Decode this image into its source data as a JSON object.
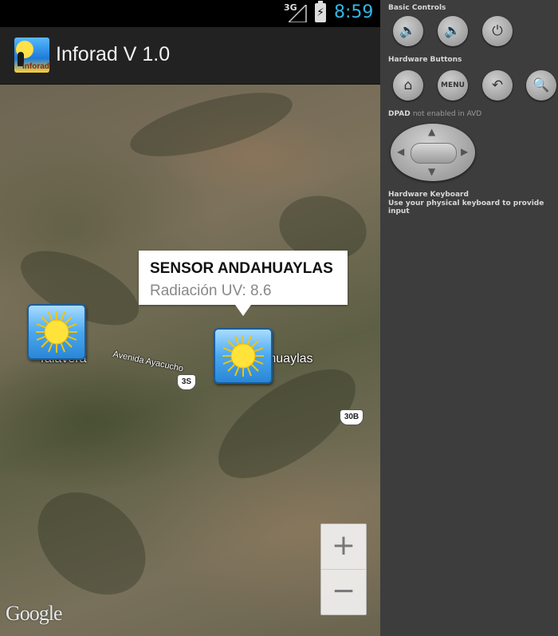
{
  "status_bar": {
    "network_type": "3G",
    "time": "8:59",
    "battery_icon": "battery-charging-icon",
    "signal_icon": "signal-icon"
  },
  "action_bar": {
    "app_icon_text": "inforad",
    "title": "Inforad V 1.0"
  },
  "map": {
    "place_labels": [
      "Talavera",
      "Avenida Ayacucho",
      "Andahuaylas"
    ],
    "route_shields": [
      "3S",
      "30B"
    ],
    "info_window": {
      "title": "SENSOR ANDAHUAYLAS",
      "snippet": "Radiación UV: 8.6"
    },
    "markers": [
      "sun-marker-icon",
      "sun-marker-icon"
    ],
    "zoom_in": "+",
    "zoom_out": "−",
    "attribution": "Google"
  },
  "emulator_controls": {
    "basic_controls_label": "Basic Controls",
    "basic_buttons": [
      {
        "icon": "volume-down-icon",
        "glyph": "🔉"
      },
      {
        "icon": "volume-up-icon",
        "glyph": "🔊"
      },
      {
        "icon": "power-icon",
        "glyph": "⏻"
      }
    ],
    "hardware_buttons_label": "Hardware Buttons",
    "hardware_buttons": [
      {
        "icon": "home-icon",
        "glyph": "⌂"
      },
      {
        "icon": "menu-button",
        "label": "MENU"
      },
      {
        "icon": "back-icon",
        "glyph": "↶"
      },
      {
        "icon": "search-icon",
        "glyph": "🔍"
      }
    ],
    "dpad_label": "DPAD",
    "dpad_note": "not enabled in AVD",
    "keyboard_label": "Hardware Keyboard",
    "keyboard_note": "Use your physical keyboard to provide input"
  },
  "colors": {
    "status_time": "#33b5e5",
    "action_bar": "#222222",
    "controls_bg": "#3d3d3d"
  }
}
